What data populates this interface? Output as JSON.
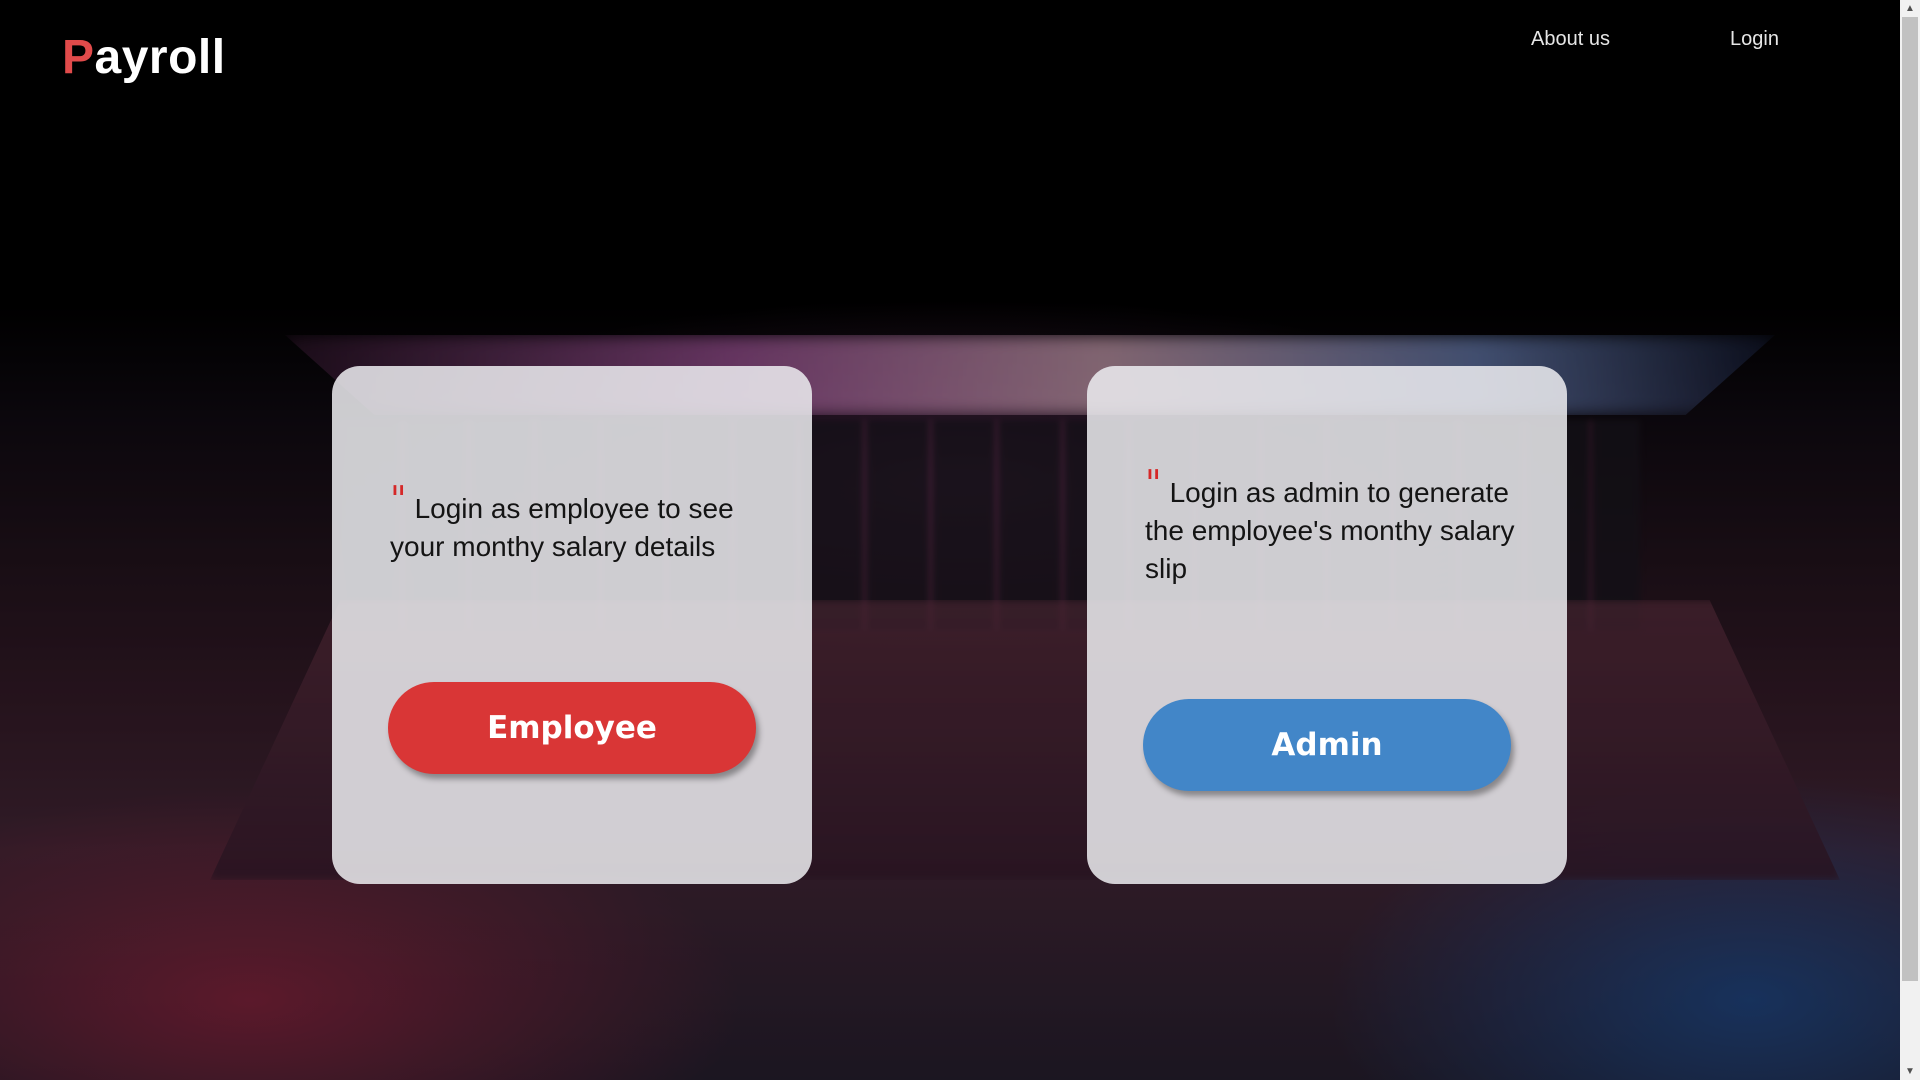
{
  "brand": {
    "first_letter": "P",
    "rest": "ayroll"
  },
  "nav": {
    "about": "About us",
    "login": "Login"
  },
  "cards": {
    "employee": {
      "quote_mark": "\"",
      "text": "Login as employee to see your monthy salary details",
      "button": "Employee"
    },
    "admin": {
      "quote_mark": "\"",
      "text": "Login as admin to generate the employee's monthy salary slip",
      "button": "Admin"
    }
  },
  "colors": {
    "accent_red": "#d93636",
    "accent_blue": "#4286c8",
    "logo_red": "#e14b4b"
  }
}
